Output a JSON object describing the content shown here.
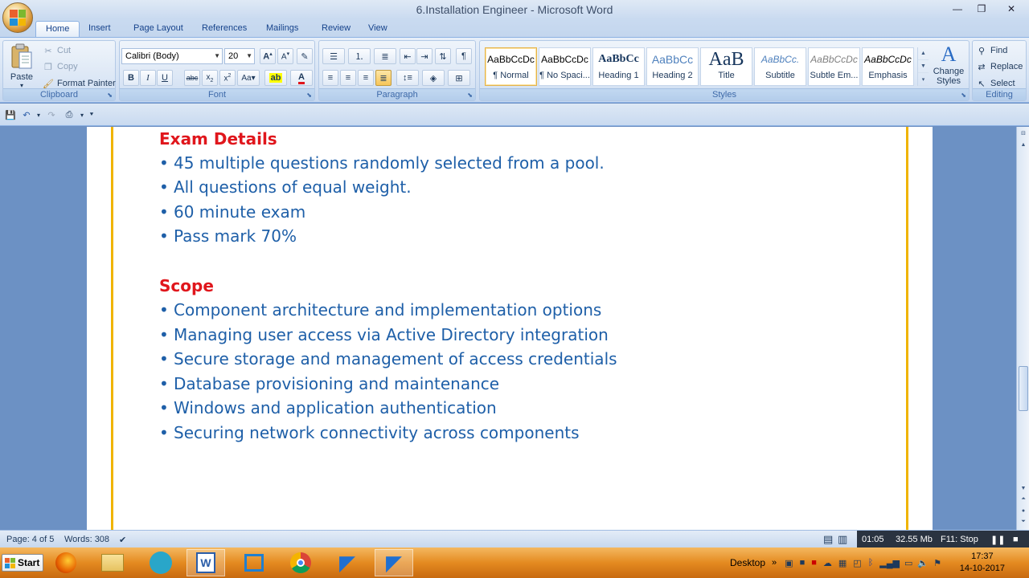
{
  "window": {
    "title": "6.Installation Engineer - Microsoft Word",
    "minimize": "—",
    "restore": "❐",
    "close": "✕"
  },
  "tabs": [
    "Home",
    "Insert",
    "Page Layout",
    "References",
    "Mailings",
    "Review",
    "View"
  ],
  "clipboard": {
    "paste": "Paste",
    "cut": "Cut",
    "copy": "Copy",
    "format_painter": "Format Painter",
    "label": "Clipboard"
  },
  "font": {
    "name": "Calibri (Body)",
    "size": "20",
    "label": "Font"
  },
  "paragraph": {
    "label": "Paragraph"
  },
  "styles": {
    "items": [
      {
        "sample": "AaBbCcDc",
        "name": "¶ Normal"
      },
      {
        "sample": "AaBbCcDc",
        "name": "¶ No Spaci..."
      },
      {
        "sample": "AaBbCс",
        "name": "Heading 1"
      },
      {
        "sample": "AaBbCc",
        "name": "Heading 2"
      },
      {
        "sample": "AaB",
        "name": "Title"
      },
      {
        "sample": "AaBbCc.",
        "name": "Subtitle"
      },
      {
        "sample": "AaBbCcDc",
        "name": "Subtle Em..."
      },
      {
        "sample": "AaBbCcDc",
        "name": "Emphasis"
      }
    ],
    "change_styles": "Change Styles",
    "label": "Styles"
  },
  "editing": {
    "find": "Find",
    "replace": "Replace",
    "select": "Select",
    "label": "Editing"
  },
  "document": {
    "sections": [
      {
        "heading": "Exam Details",
        "bullets": [
          "45 multiple questions randomly selected from a pool.",
          "All questions of equal weight.",
          "60 minute exam",
          "Pass mark 70%"
        ]
      },
      {
        "heading": "Scope",
        "bullets": [
          "Component architecture and implementation options",
          "Managing user access via Active Directory integration",
          "Secure storage and management of access credentials",
          "Database provisioning and maintenance",
          "Windows and application authentication",
          "Securing network connectivity across components"
        ]
      }
    ],
    "bullet_char": "•"
  },
  "status": {
    "page": "Page: 4 of 5",
    "words": "Words: 308",
    "rec_time": "01:05",
    "rec_size": "32.55 Mb",
    "rec_stop": "F11: Stop"
  },
  "taskbar": {
    "start": "Start",
    "desktop": "Desktop",
    "time": "17:37",
    "date": "14-10-2017"
  },
  "colors": {
    "heading": "#e0161c",
    "bullet_text": "#1e5fa8",
    "page_border": "#f0b400",
    "taskbar": "#e48a20"
  }
}
